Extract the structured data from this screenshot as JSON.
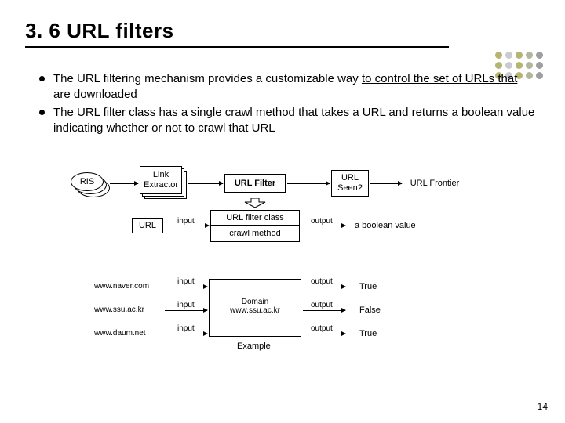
{
  "title": "3. 6 URL filters",
  "bullets": [
    {
      "pre": "The URL filtering mechanism provides a customizable way ",
      "u": "to control the set of URLs that are downloaded"
    },
    {
      "pre": "The URL filter class has a single crawl method that takes a URL and returns a boolean value indicating whether or not to crawl that URL",
      "u": ""
    }
  ],
  "pipeline": {
    "ris": "RIS",
    "linkextractor": "Link\nExtractor",
    "urlfilter": "URL Filter",
    "urlseen": "URL\nSeen?",
    "urlfrontier": "URL Frontier"
  },
  "method": {
    "url": "URL",
    "input": "input",
    "filterclass": "URL filter class",
    "output": "output",
    "boolean": "a boolean value",
    "crawl": "crawl method"
  },
  "example": {
    "rows": [
      {
        "site": "www.naver.com",
        "out": "True"
      },
      {
        "site": "www.ssu.ac.kr",
        "out": "False"
      },
      {
        "site": "www.daum.net",
        "out": "True"
      }
    ],
    "domain": "Domain\nwww.ssu.ac.kr",
    "caption": "Example",
    "input": "input",
    "output": "output"
  },
  "page": "14"
}
